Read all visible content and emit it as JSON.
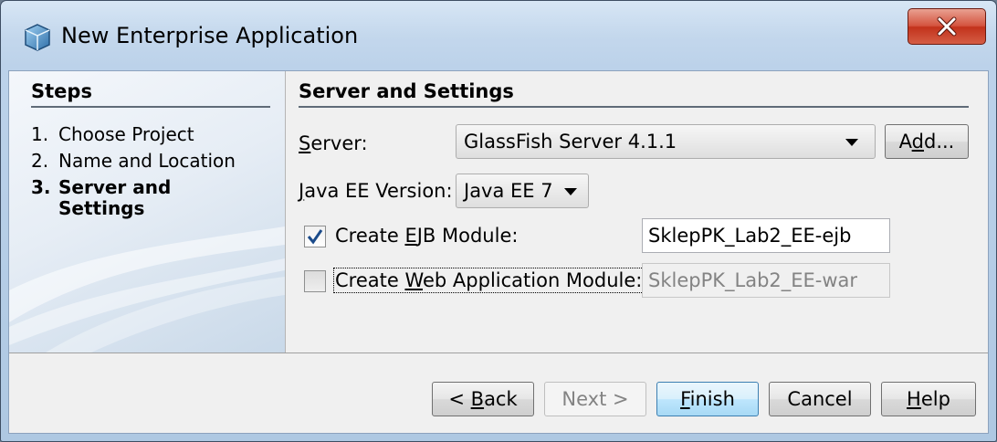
{
  "window": {
    "title": "New Enterprise Application"
  },
  "steps": {
    "heading": "Steps",
    "items": [
      {
        "num": "1.",
        "label": "Choose Project"
      },
      {
        "num": "2.",
        "label": "Name and Location"
      },
      {
        "num": "3.",
        "label_line1": "Server and",
        "label_line2": "Settings",
        "current": true
      }
    ]
  },
  "panel": {
    "heading": "Server and Settings",
    "server": {
      "label_mnemonic": "S",
      "label_rest": "erver:",
      "value": "GlassFish Server 4.1.1",
      "add_button_pre": "A",
      "add_button_mnemonic": "d",
      "add_button_post": "d..."
    },
    "java_ee": {
      "label_mnemonic": "J",
      "label_rest": "ava EE Version:",
      "value": "Java EE 7"
    },
    "ejb": {
      "checked": true,
      "label_pre": "Create ",
      "label_mnemonic": "E",
      "label_post": "JB Module:",
      "value": "SklepPK_Lab2_EE-ejb"
    },
    "web": {
      "checked": false,
      "label_pre": "Create ",
      "label_mnemonic": "W",
      "label_post": "eb Application Module:",
      "value": "SklepPK_Lab2_EE-war"
    }
  },
  "buttons": {
    "back_pre": "< ",
    "back_mnemonic": "B",
    "back_post": "ack",
    "next": "Next >",
    "finish_mnemonic": "F",
    "finish_post": "inish",
    "cancel": "Cancel",
    "help_mnemonic": "H",
    "help_post": "elp"
  },
  "icons": {
    "app": "enterprise-app-icon",
    "close": "close-icon",
    "check": "checkmark-icon",
    "dropdown": "chevron-down-icon"
  },
  "colors": {
    "title_gradient_top": "#d7e6f5",
    "close_button": "#c2321b",
    "default_button": "#a7d9f5"
  }
}
